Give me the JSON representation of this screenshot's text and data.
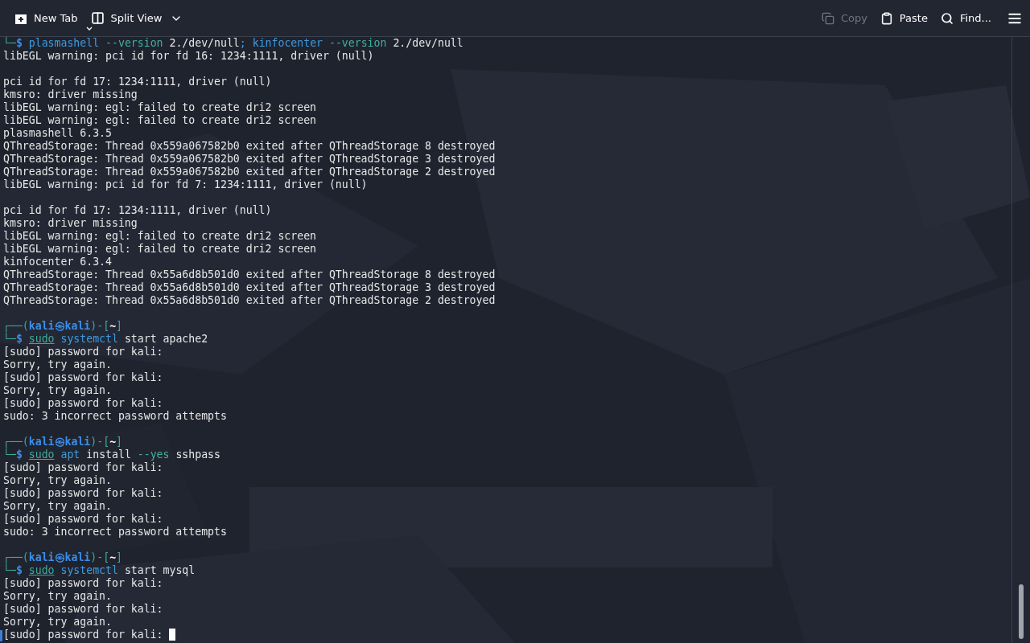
{
  "toolbar": {
    "left": [
      {
        "kind": "new-tab",
        "label": "New Tab",
        "disabled": false
      },
      {
        "kind": "split-view",
        "label": "Split View",
        "disabled": false
      }
    ],
    "right": [
      {
        "kind": "copy",
        "label": "Copy",
        "disabled": true
      },
      {
        "kind": "paste",
        "label": "Paste",
        "disabled": false
      },
      {
        "kind": "find",
        "label": "Find...",
        "disabled": false
      }
    ]
  },
  "terminal": {
    "cursor": true,
    "lines": [
      {
        "kind": "text",
        "segments": [
          {
            "kind": "frame",
            "text": "└─"
          },
          {
            "kind": "user",
            "text": "$ "
          },
          {
            "kind": "command",
            "text": "plasmashell"
          },
          {
            "kind": "option",
            "text": " --version"
          },
          {
            "kind": "plain",
            "text": " 2./dev/null"
          },
          {
            "kind": "command",
            "text": "; kinfocenter"
          },
          {
            "kind": "option",
            "text": " --version"
          },
          {
            "kind": "plain",
            "text": " 2./dev/null"
          }
        ]
      },
      {
        "kind": "text",
        "segments": [
          {
            "kind": "plain",
            "text": "libEGL warning: pci id for fd 16: 1234:1111, driver (null)"
          }
        ]
      },
      {
        "kind": "blank"
      },
      {
        "kind": "text",
        "segments": [
          {
            "kind": "plain",
            "text": "pci id for fd 17: 1234:1111, driver (null)"
          }
        ]
      },
      {
        "kind": "text",
        "segments": [
          {
            "kind": "plain",
            "text": "kmsro: driver missing"
          }
        ]
      },
      {
        "kind": "text",
        "segments": [
          {
            "kind": "plain",
            "text": "libEGL warning: egl: failed to create dri2 screen"
          }
        ]
      },
      {
        "kind": "text",
        "segments": [
          {
            "kind": "plain",
            "text": "libEGL warning: egl: failed to create dri2 screen"
          }
        ]
      },
      {
        "kind": "text",
        "segments": [
          {
            "kind": "plain",
            "text": "plasmashell 6.3.5"
          }
        ]
      },
      {
        "kind": "text",
        "segments": [
          {
            "kind": "plain",
            "text": "QThreadStorage: Thread 0x559a067582b0 exited after QThreadStorage 8 destroyed"
          }
        ]
      },
      {
        "kind": "text",
        "segments": [
          {
            "kind": "plain",
            "text": "QThreadStorage: Thread 0x559a067582b0 exited after QThreadStorage 3 destroyed"
          }
        ]
      },
      {
        "kind": "text",
        "segments": [
          {
            "kind": "plain",
            "text": "QThreadStorage: Thread 0x559a067582b0 exited after QThreadStorage 2 destroyed"
          }
        ]
      },
      {
        "kind": "text",
        "segments": [
          {
            "kind": "plain",
            "text": "libEGL warning: pci id for fd 7: 1234:1111, driver (null)"
          }
        ]
      },
      {
        "kind": "blank"
      },
      {
        "kind": "text",
        "segments": [
          {
            "kind": "plain",
            "text": "pci id for fd 17: 1234:1111, driver (null)"
          }
        ]
      },
      {
        "kind": "text",
        "segments": [
          {
            "kind": "plain",
            "text": "kmsro: driver missing"
          }
        ]
      },
      {
        "kind": "text",
        "segments": [
          {
            "kind": "plain",
            "text": "libEGL warning: egl: failed to create dri2 screen"
          }
        ]
      },
      {
        "kind": "text",
        "segments": [
          {
            "kind": "plain",
            "text": "libEGL warning: egl: failed to create dri2 screen"
          }
        ]
      },
      {
        "kind": "text",
        "segments": [
          {
            "kind": "plain",
            "text": "kinfocenter 6.3.4"
          }
        ]
      },
      {
        "kind": "text",
        "segments": [
          {
            "kind": "plain",
            "text": "QThreadStorage: Thread 0x55a6d8b501d0 exited after QThreadStorage 8 destroyed"
          }
        ]
      },
      {
        "kind": "text",
        "segments": [
          {
            "kind": "plain",
            "text": "QThreadStorage: Thread 0x55a6d8b501d0 exited after QThreadStorage 3 destroyed"
          }
        ]
      },
      {
        "kind": "text",
        "segments": [
          {
            "kind": "plain",
            "text": "QThreadStorage: Thread 0x55a6d8b501d0 exited after QThreadStorage 2 destroyed"
          }
        ]
      },
      {
        "kind": "blank"
      },
      {
        "kind": "text",
        "segments": [
          {
            "kind": "frame",
            "text": "┌──("
          },
          {
            "kind": "user",
            "text": "kali㉿kali"
          },
          {
            "kind": "frame",
            "text": ")-["
          },
          {
            "kind": "path",
            "text": "~"
          },
          {
            "kind": "frame",
            "text": "]"
          }
        ]
      },
      {
        "kind": "text",
        "segments": [
          {
            "kind": "frame",
            "text": "└─"
          },
          {
            "kind": "user",
            "text": "$ "
          },
          {
            "kind": "sudo",
            "text": "sudo"
          },
          {
            "kind": "command",
            "text": " systemctl"
          },
          {
            "kind": "plain",
            "text": " start apache2"
          }
        ]
      },
      {
        "kind": "text",
        "segments": [
          {
            "kind": "plain",
            "text": "[sudo] password for kali:"
          }
        ]
      },
      {
        "kind": "text",
        "segments": [
          {
            "kind": "plain",
            "text": "Sorry, try again."
          }
        ]
      },
      {
        "kind": "text",
        "segments": [
          {
            "kind": "plain",
            "text": "[sudo] password for kali:"
          }
        ]
      },
      {
        "kind": "text",
        "segments": [
          {
            "kind": "plain",
            "text": "Sorry, try again."
          }
        ]
      },
      {
        "kind": "text",
        "segments": [
          {
            "kind": "plain",
            "text": "[sudo] password for kali:"
          }
        ]
      },
      {
        "kind": "text",
        "segments": [
          {
            "kind": "plain",
            "text": "sudo: 3 incorrect password attempts"
          }
        ]
      },
      {
        "kind": "blank"
      },
      {
        "kind": "text",
        "segments": [
          {
            "kind": "frame",
            "text": "┌──("
          },
          {
            "kind": "user",
            "text": "kali㉿kali"
          },
          {
            "kind": "frame",
            "text": ")-["
          },
          {
            "kind": "path",
            "text": "~"
          },
          {
            "kind": "frame",
            "text": "]"
          }
        ]
      },
      {
        "kind": "text",
        "segments": [
          {
            "kind": "frame",
            "text": "└─"
          },
          {
            "kind": "user",
            "text": "$ "
          },
          {
            "kind": "sudo",
            "text": "sudo"
          },
          {
            "kind": "command",
            "text": " apt"
          },
          {
            "kind": "plain",
            "text": " install"
          },
          {
            "kind": "option",
            "text": " --yes"
          },
          {
            "kind": "plain",
            "text": " sshpass"
          }
        ]
      },
      {
        "kind": "text",
        "segments": [
          {
            "kind": "plain",
            "text": "[sudo] password for kali:"
          }
        ]
      },
      {
        "kind": "text",
        "segments": [
          {
            "kind": "plain",
            "text": "Sorry, try again."
          }
        ]
      },
      {
        "kind": "text",
        "segments": [
          {
            "kind": "plain",
            "text": "[sudo] password for kali:"
          }
        ]
      },
      {
        "kind": "text",
        "segments": [
          {
            "kind": "plain",
            "text": "Sorry, try again."
          }
        ]
      },
      {
        "kind": "text",
        "segments": [
          {
            "kind": "plain",
            "text": "[sudo] password for kali:"
          }
        ]
      },
      {
        "kind": "text",
        "segments": [
          {
            "kind": "plain",
            "text": "sudo: 3 incorrect password attempts"
          }
        ]
      },
      {
        "kind": "blank"
      },
      {
        "kind": "text",
        "segments": [
          {
            "kind": "frame",
            "text": "┌──("
          },
          {
            "kind": "user",
            "text": "kali㉿kali"
          },
          {
            "kind": "frame",
            "text": ")-["
          },
          {
            "kind": "path",
            "text": "~"
          },
          {
            "kind": "frame",
            "text": "]"
          }
        ]
      },
      {
        "kind": "text",
        "segments": [
          {
            "kind": "frame",
            "text": "└─"
          },
          {
            "kind": "user",
            "text": "$ "
          },
          {
            "kind": "sudo",
            "text": "sudo"
          },
          {
            "kind": "command",
            "text": " systemctl"
          },
          {
            "kind": "plain",
            "text": " start mysql"
          }
        ]
      },
      {
        "kind": "text",
        "segments": [
          {
            "kind": "plain",
            "text": "[sudo] password for kali:"
          }
        ]
      },
      {
        "kind": "text",
        "segments": [
          {
            "kind": "plain",
            "text": "Sorry, try again."
          }
        ]
      },
      {
        "kind": "text",
        "segments": [
          {
            "kind": "plain",
            "text": "[sudo] password for kali:"
          }
        ]
      },
      {
        "kind": "text",
        "segments": [
          {
            "kind": "plain",
            "text": "Sorry, try again."
          }
        ]
      },
      {
        "kind": "text",
        "segments": [
          {
            "kind": "plain",
            "text": "[sudo] password for kali: "
          }
        ]
      }
    ]
  }
}
